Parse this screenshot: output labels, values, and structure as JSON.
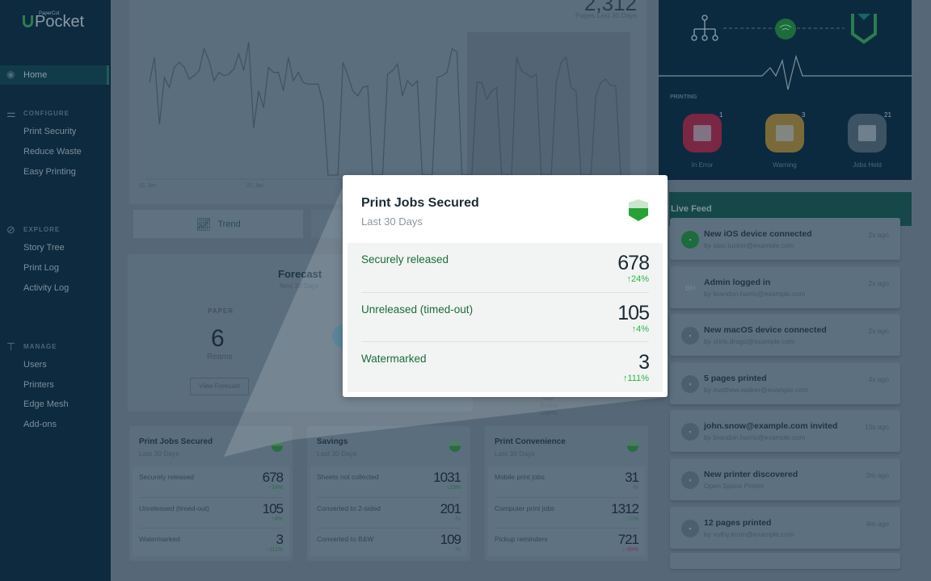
{
  "brand": {
    "small": "PaperCut",
    "name": "Pocket"
  },
  "sidebar": {
    "home": "Home",
    "sections": [
      {
        "title": "CONFIGURE",
        "icon": "sliders-icon",
        "items": [
          "Print Security",
          "Reduce Waste",
          "Easy Printing"
        ]
      },
      {
        "title": "EXPLORE",
        "icon": "compass-icon",
        "items": [
          "Story Tree",
          "Print Log",
          "Activity Log"
        ]
      },
      {
        "title": "MANAGE",
        "icon": "signpost-icon",
        "items": [
          "Users",
          "Printers",
          "Edge Mesh",
          "Add-ons"
        ]
      }
    ]
  },
  "pages_chart": {
    "total": "2,312",
    "caption": "Pages Last 30 Days",
    "x_ticks": [
      "01 Jan",
      "20 Jan"
    ],
    "values": [
      55,
      70,
      30,
      58,
      52,
      64,
      67,
      64,
      57,
      59,
      62,
      75,
      68,
      56,
      61,
      59,
      60,
      63,
      72,
      62,
      79,
      28,
      50,
      40,
      64,
      61,
      61,
      50,
      70,
      56,
      61,
      55,
      54,
      54,
      54,
      43,
      0,
      0,
      0,
      67,
      59,
      50,
      47,
      52,
      53,
      0,
      0,
      0,
      60,
      62,
      66,
      47,
      56,
      53,
      56,
      0,
      0,
      0,
      58,
      59,
      61,
      75,
      73,
      0,
      0,
      0,
      55,
      55,
      45,
      50,
      52,
      0,
      0,
      0,
      70,
      62,
      60,
      58,
      60,
      0,
      0,
      0,
      55,
      67,
      70,
      52,
      50,
      0,
      0,
      0,
      47,
      55,
      57,
      53,
      53,
      0
    ],
    "trend_label": "Trend"
  },
  "forecast": {
    "title": "Forecast",
    "subtitle": "Next 30 Days",
    "paper_label": "PAPER",
    "paper_value": "6",
    "paper_unit": "Reams",
    "button": "View Forecast",
    "users_caption": "Total Active Users"
  },
  "status": {
    "section": "PRINTING",
    "printers": [
      {
        "label": "In Error",
        "count": "1",
        "color": "#7a2744"
      },
      {
        "label": "Warning",
        "count": "3",
        "color": "#7a6a3a"
      },
      {
        "label": "Jobs Held",
        "count": "21",
        "color": "#3d5263"
      }
    ]
  },
  "live_feed": {
    "title": "Live Feed",
    "items": [
      {
        "icon": "android-icon",
        "title": "New iOS device connected",
        "sub": "by xiao.tucker@example.com",
        "time": "2s ago"
      },
      {
        "icon": "avatar-initials",
        "initials": "BH",
        "title": "Admin logged in",
        "sub": "by brandon.harris@example.com",
        "time": "2s ago"
      },
      {
        "icon": "finder-icon",
        "title": "New macOS device connected",
        "sub": "by chris.drogo@example.com",
        "time": "2s ago"
      },
      {
        "icon": "document-icon",
        "title": "5 pages printed",
        "sub": "by matthew.walker@example.com",
        "time": "4s ago"
      },
      {
        "icon": "send-icon",
        "title": "john.snow@example.com invited",
        "sub": "by brandon.harris@example.com",
        "time": "10s ago"
      },
      {
        "icon": "printer-icon",
        "title": "New printer discovered",
        "sub": "Open Space Printer",
        "time": "2m ago"
      },
      {
        "icon": "document-icon",
        "title": "12 pages printed",
        "sub": "by vuthy.krum@example.com",
        "time": "4m ago"
      }
    ]
  },
  "cards": [
    {
      "title": "Print Jobs Secured",
      "subtitle": "Last 30 Days",
      "icon": "shield-icon",
      "rows": [
        {
          "label": "Securely released",
          "value": "678",
          "change": "↑24%"
        },
        {
          "label": "Unreleased (timed-out)",
          "value": "105",
          "change": "↑4%"
        },
        {
          "label": "Watermarked",
          "value": "3",
          "change": "↑111%"
        }
      ]
    },
    {
      "title": "Savings",
      "subtitle": "Last 30 Days",
      "icon": "stars-icon",
      "rows": [
        {
          "label": "Sheets not collected",
          "value": "1031",
          "change": "↑23%"
        },
        {
          "label": "Converted to 2-sided",
          "value": "201",
          "change": "-%"
        },
        {
          "label": "Converted to B&W",
          "value": "109",
          "change": "-%"
        }
      ]
    },
    {
      "title": "Print Convenience",
      "subtitle": "Last 30 Days",
      "icon": "smile-icon",
      "rows": [
        {
          "label": "Mobile print jobs",
          "value": "31",
          "change": "-%"
        },
        {
          "label": "Computer print jobs",
          "value": "1312",
          "change": "↑1%"
        },
        {
          "label": "Pickup reminders",
          "value": "721",
          "change": "↓-99%",
          "down": true
        }
      ]
    }
  ],
  "popup": {
    "title": "Print Jobs Secured",
    "subtitle": "Last 30 Days",
    "icon": "shield-icon",
    "rows": [
      {
        "label": "Securely released",
        "value": "678",
        "change": "↑24%"
      },
      {
        "label": "Unreleased (timed-out)",
        "value": "105",
        "change": "↑4%"
      },
      {
        "label": "Watermarked",
        "value": "3",
        "change": "↑111%"
      }
    ]
  },
  "colors": {
    "accent_green": "#2db34a",
    "sidebar": "#0d2a3f",
    "popup_label": "#1f6b3a"
  }
}
